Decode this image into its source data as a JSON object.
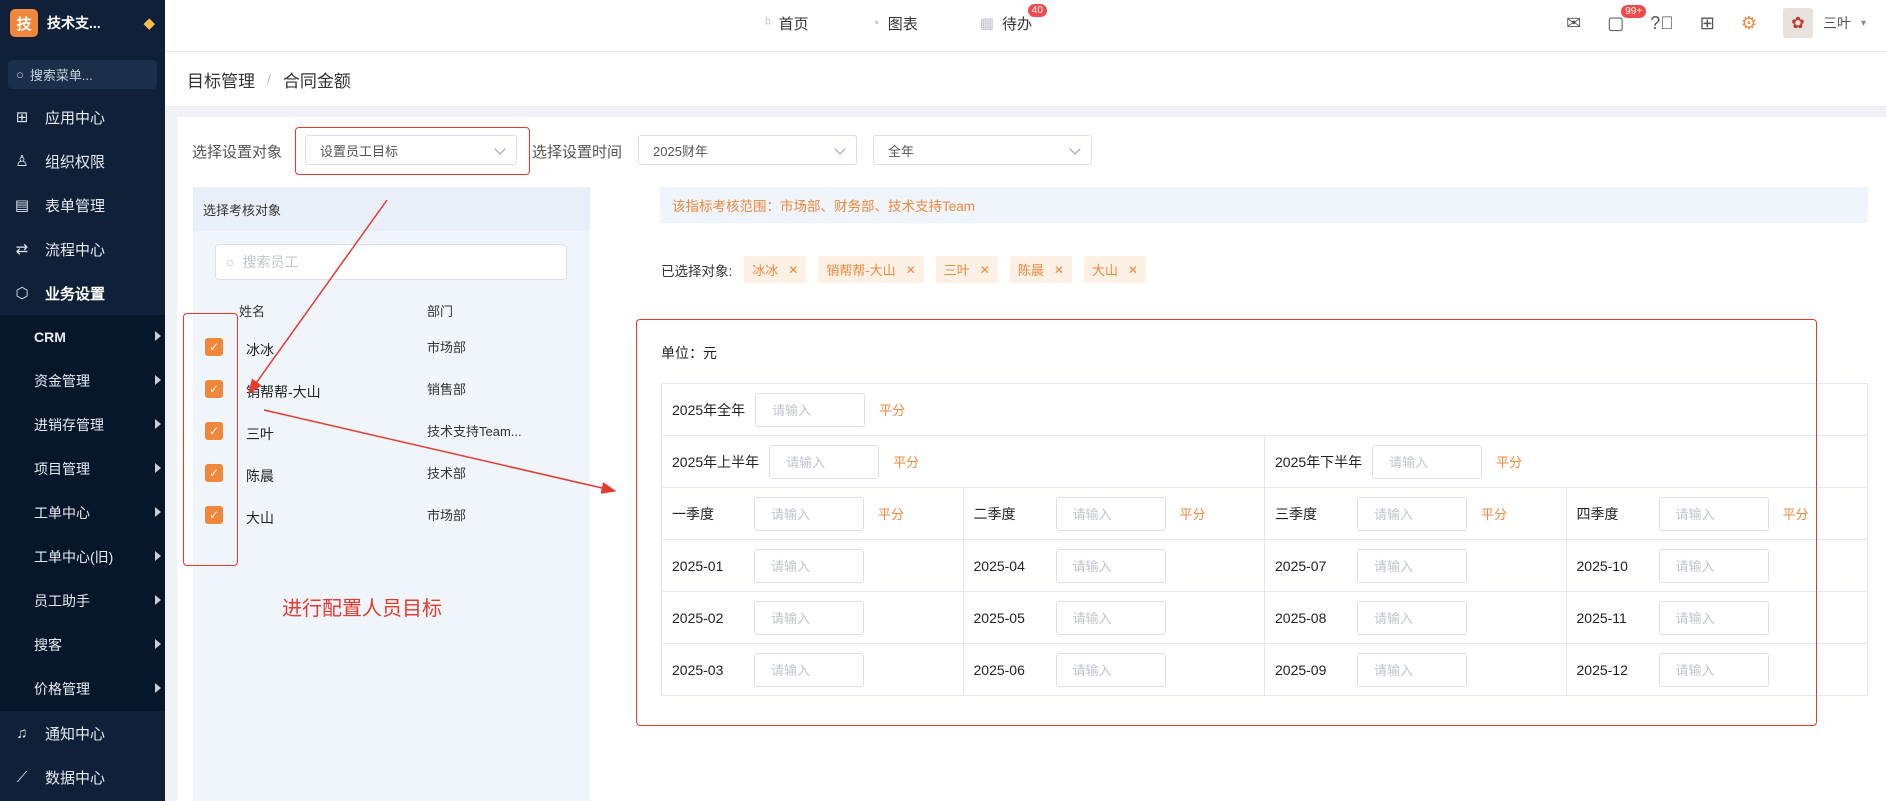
{
  "sidebar": {
    "brand": {
      "logo": "技",
      "name": "技术支..."
    },
    "search_placeholder": "搜索菜单...",
    "top_items": [
      {
        "label": "应用中心",
        "icon": "grid-icon"
      },
      {
        "label": "组织权限",
        "icon": "user-icon"
      },
      {
        "label": "表单管理",
        "icon": "form-icon"
      },
      {
        "label": "流程中心",
        "icon": "flow-icon"
      },
      {
        "label": "业务设置",
        "icon": "cube-icon"
      }
    ],
    "sub_items": [
      "CRM",
      "资金管理",
      "进销存管理",
      "项目管理",
      "工单中心",
      "工单中心(旧)",
      "员工助手",
      "搜客",
      "价格管理"
    ],
    "bottom_items": [
      {
        "label": "通知中心",
        "icon": "bell-icon"
      },
      {
        "label": "数据中心",
        "icon": "chart-icon"
      }
    ]
  },
  "topnav": {
    "items": [
      {
        "label": "首页",
        "icon": "home-icon"
      },
      {
        "label": "图表",
        "icon": "pie-icon"
      },
      {
        "label": "待办",
        "icon": "calendar-icon",
        "badge": "40"
      }
    ],
    "msg_badge": "99+",
    "user_name": "三叶"
  },
  "breadcrumb": {
    "parent": "目标管理",
    "sep": "/",
    "current": "合同金额"
  },
  "filters": {
    "object_label": "选择设置对象",
    "object_value": "设置员工目标",
    "time_label": "选择设置时间",
    "year_value": "2025财年",
    "period_value": "全年"
  },
  "left_panel": {
    "title": "选择考核对象",
    "search_placeholder": "搜索员工",
    "col_name": "姓名",
    "col_dept": "部门",
    "rows": [
      {
        "name": "冰冰",
        "dept": "市场部",
        "checked": true
      },
      {
        "name": "销帮帮-大山",
        "dept": "销售部",
        "checked": true
      },
      {
        "name": "三叶",
        "dept": "技术支持Team...",
        "checked": true
      },
      {
        "name": "陈晨",
        "dept": "技术部",
        "checked": true
      },
      {
        "name": "大山",
        "dept": "市场部",
        "checked": true
      }
    ]
  },
  "annotation": "进行配置人员目标",
  "scope_text": "该指标考核范围：市场部、财务部、技术支持Team",
  "chosen": {
    "label": "已选择对象:",
    "tags": [
      "冰冰",
      "销帮帮-大山",
      "三叶",
      "陈晨",
      "大山"
    ]
  },
  "targets": {
    "unit": "单位：元",
    "placeholder": "请输入",
    "avg": "平分",
    "year": "2025年全年",
    "halves": [
      "2025年上半年",
      "2025年下半年"
    ],
    "quarters": [
      "一季度",
      "二季度",
      "三季度",
      "四季度"
    ],
    "months": [
      [
        "2025-01",
        "2025-04",
        "2025-07",
        "2025-10"
      ],
      [
        "2025-02",
        "2025-05",
        "2025-08",
        "2025-11"
      ],
      [
        "2025-03",
        "2025-06",
        "2025-09",
        "2025-12"
      ]
    ]
  },
  "colors": {
    "accent": "#f0873a",
    "sidebar": "#0f2038",
    "annotation_red": "#e53a2c",
    "badge": "#f04a4a"
  }
}
